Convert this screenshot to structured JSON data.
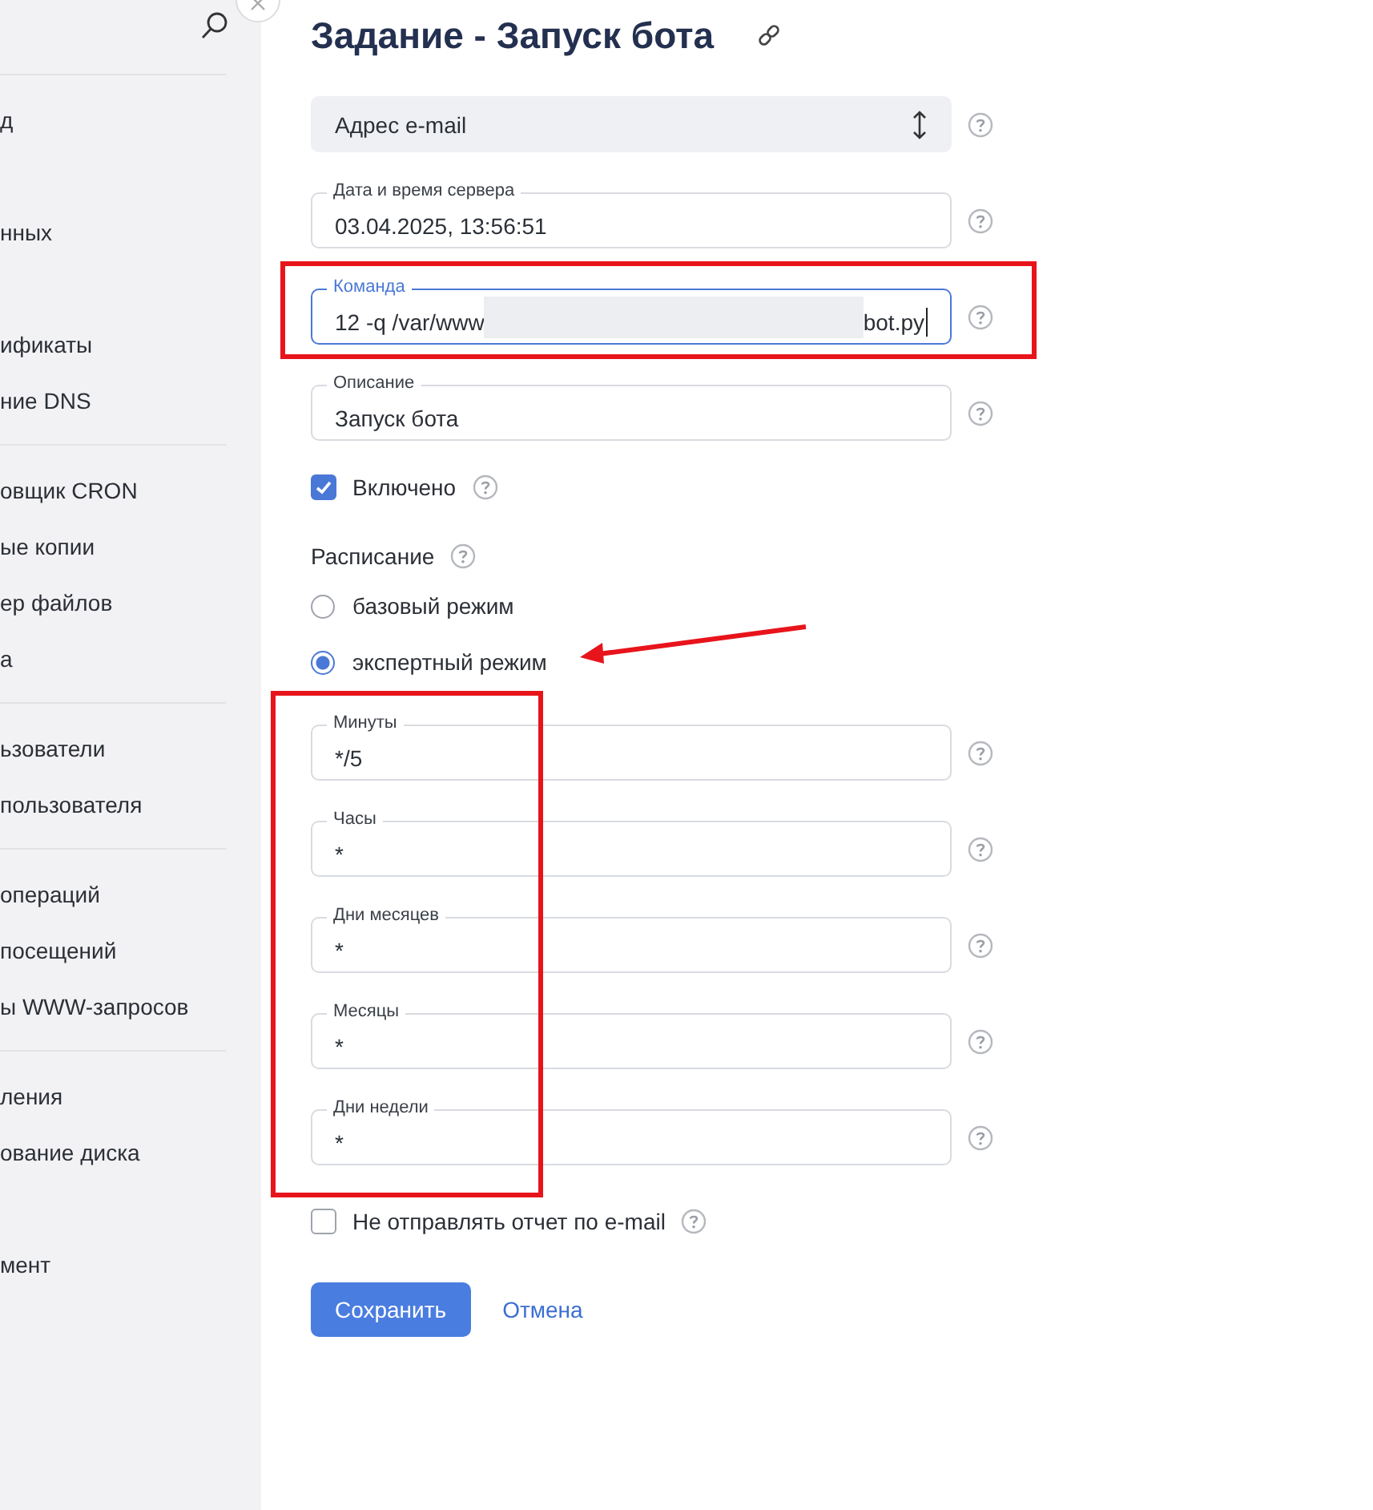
{
  "sidebar": {
    "groups": [
      {
        "items": [
          "д",
          "нных",
          "ификаты",
          "ние DNS"
        ]
      },
      {
        "items": [
          "овщик CRON",
          "ые копии",
          "ер файлов",
          "а"
        ]
      },
      {
        "items": [
          "ьзователи",
          "пользователя"
        ]
      },
      {
        "items": [
          "операций",
          "посещений",
          "ы WWW-запросов"
        ]
      },
      {
        "items": [
          "ления",
          "ование диска",
          "мент"
        ]
      }
    ]
  },
  "title": "Задание - Запуск бота",
  "form": {
    "select": {
      "value": "Адрес e-mail"
    },
    "fields": [
      {
        "label": "Дата и время сервера",
        "value": "03.04.2025, 13:56:51",
        "focused": false
      },
      {
        "label": "Команда",
        "value_parts": [
          "12 -q /var/www",
          "bot.py"
        ],
        "focused": true
      },
      {
        "label": "Описание",
        "value": "Запуск бота",
        "focused": false
      }
    ],
    "enabled": {
      "label": "Включено",
      "checked": true
    },
    "schedule": {
      "label": "Расписание",
      "options": [
        {
          "label": "базовый режим",
          "selected": false
        },
        {
          "label": "экспертный режим",
          "selected": true
        }
      ]
    },
    "cron_fields": [
      {
        "label": "Минуты",
        "value": "*/5"
      },
      {
        "label": "Часы",
        "value": "*"
      },
      {
        "label": "Дни месяцев",
        "value": "*"
      },
      {
        "label": "Месяцы",
        "value": "*"
      },
      {
        "label": "Дни недели",
        "value": "*"
      }
    ],
    "no_report": {
      "label": "Не отправлять отчет по e-mail",
      "checked": false
    },
    "buttons": {
      "save": "Сохранить",
      "cancel": "Отмена"
    }
  }
}
